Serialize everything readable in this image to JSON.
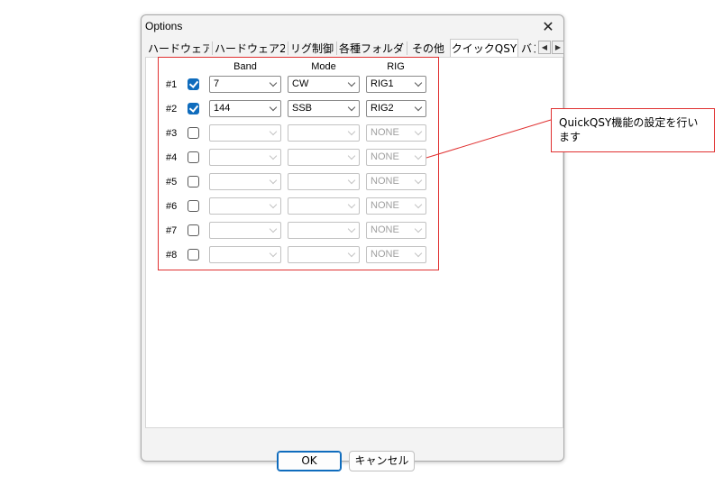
{
  "dialog": {
    "title": "Options",
    "close_glyph": "✕",
    "tabs": [
      "ハードウェア",
      "ハードウェア2",
      "リグ制御",
      "各種フォルダ",
      "その他",
      "クイックQSY",
      "バン"
    ],
    "active_tab": "クイックQSY",
    "scroll_left_glyph": "◀",
    "scroll_right_glyph": "▶"
  },
  "table": {
    "headers": {
      "band": "Band",
      "mode": "Mode",
      "rig": "RIG"
    },
    "rows": [
      {
        "label": "#1",
        "checked": true,
        "band": "7",
        "mode": "CW",
        "rig": "RIG1",
        "enabled": true
      },
      {
        "label": "#2",
        "checked": true,
        "band": "144",
        "mode": "SSB",
        "rig": "RIG2",
        "enabled": true
      },
      {
        "label": "#3",
        "checked": false,
        "band": "",
        "mode": "",
        "rig": "NONE",
        "enabled": false
      },
      {
        "label": "#4",
        "checked": false,
        "band": "",
        "mode": "",
        "rig": "NONE",
        "enabled": false
      },
      {
        "label": "#5",
        "checked": false,
        "band": "",
        "mode": "",
        "rig": "NONE",
        "enabled": false
      },
      {
        "label": "#6",
        "checked": false,
        "band": "",
        "mode": "",
        "rig": "NONE",
        "enabled": false
      },
      {
        "label": "#7",
        "checked": false,
        "band": "",
        "mode": "",
        "rig": "NONE",
        "enabled": false
      },
      {
        "label": "#8",
        "checked": false,
        "band": "",
        "mode": "",
        "rig": "NONE",
        "enabled": false
      }
    ]
  },
  "buttons": {
    "ok": "OK",
    "cancel": "キャンセル"
  },
  "callout": {
    "text": "QuickQSY機能の設定を行います"
  },
  "colors": {
    "accent": "#0f6cbd",
    "annotation": "#e03030"
  },
  "icons": {
    "close": "close-icon",
    "check": "checkmark-icon",
    "dropdown": "chevron-down-icon"
  }
}
